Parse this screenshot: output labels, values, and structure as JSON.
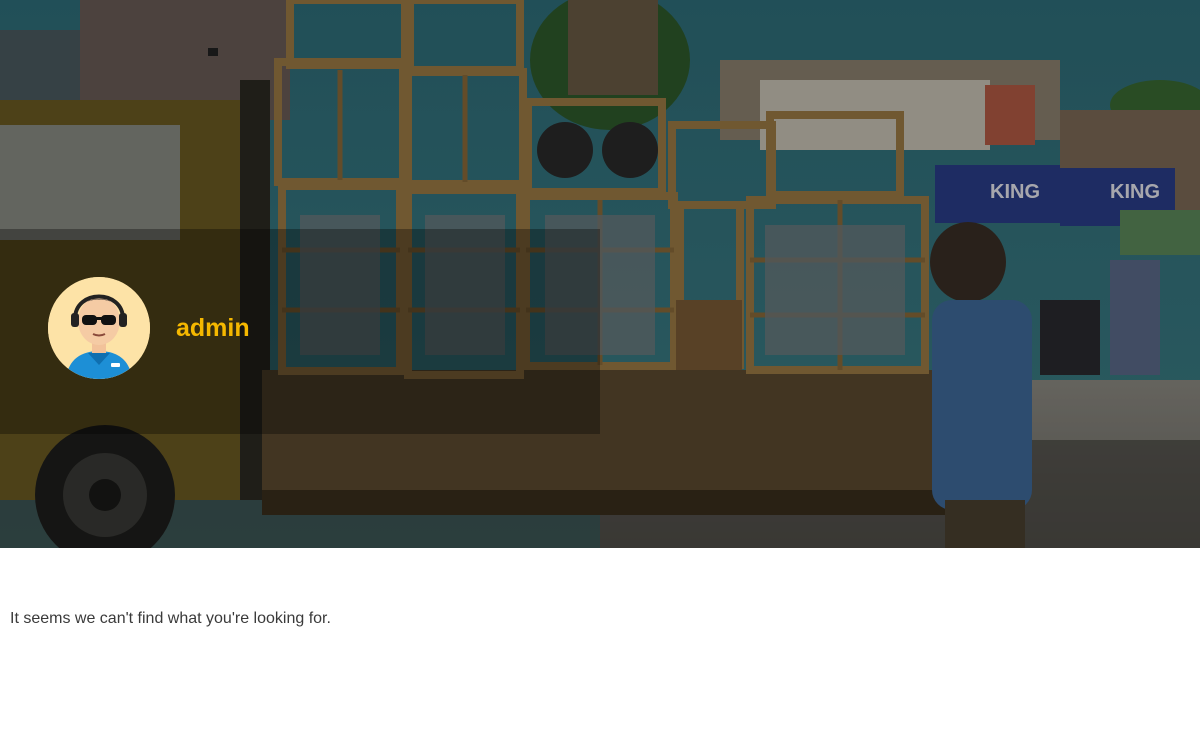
{
  "author": {
    "name": "admin",
    "avatar_icon": "avatar-icon",
    "name_color": "#f5b800"
  },
  "hero": {
    "image_icon": "hero-photo"
  },
  "content": {
    "message": "It seems we can't find what you're looking for."
  }
}
